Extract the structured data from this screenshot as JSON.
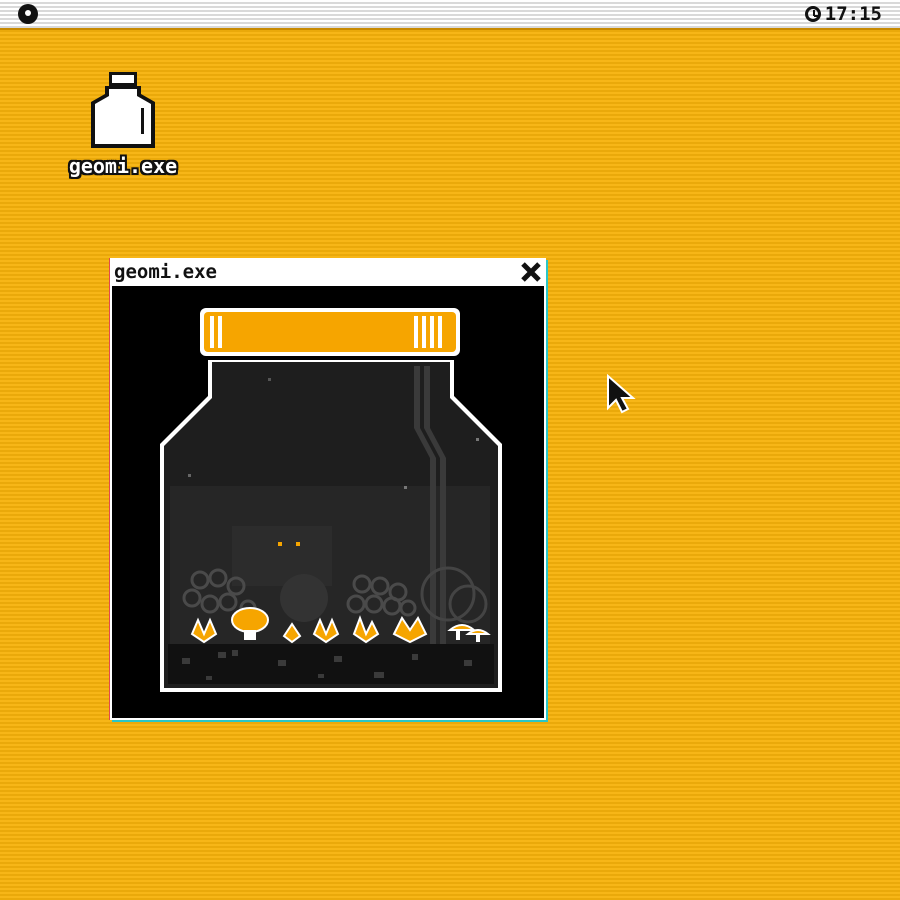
{
  "menubar": {
    "clock_time": "17:15"
  },
  "desktop": {
    "icon_label": "geomi.exe"
  },
  "window": {
    "title": "geomi.exe"
  },
  "colors": {
    "desktop": "#f7b20b",
    "accent": "#f6a500",
    "window_bg": "#000000",
    "jar_glass": "#1e1e1e"
  },
  "icons": [
    "apple-menu-icon",
    "clock-icon",
    "jar-icon",
    "close-icon",
    "mouse-cursor-icon"
  ]
}
